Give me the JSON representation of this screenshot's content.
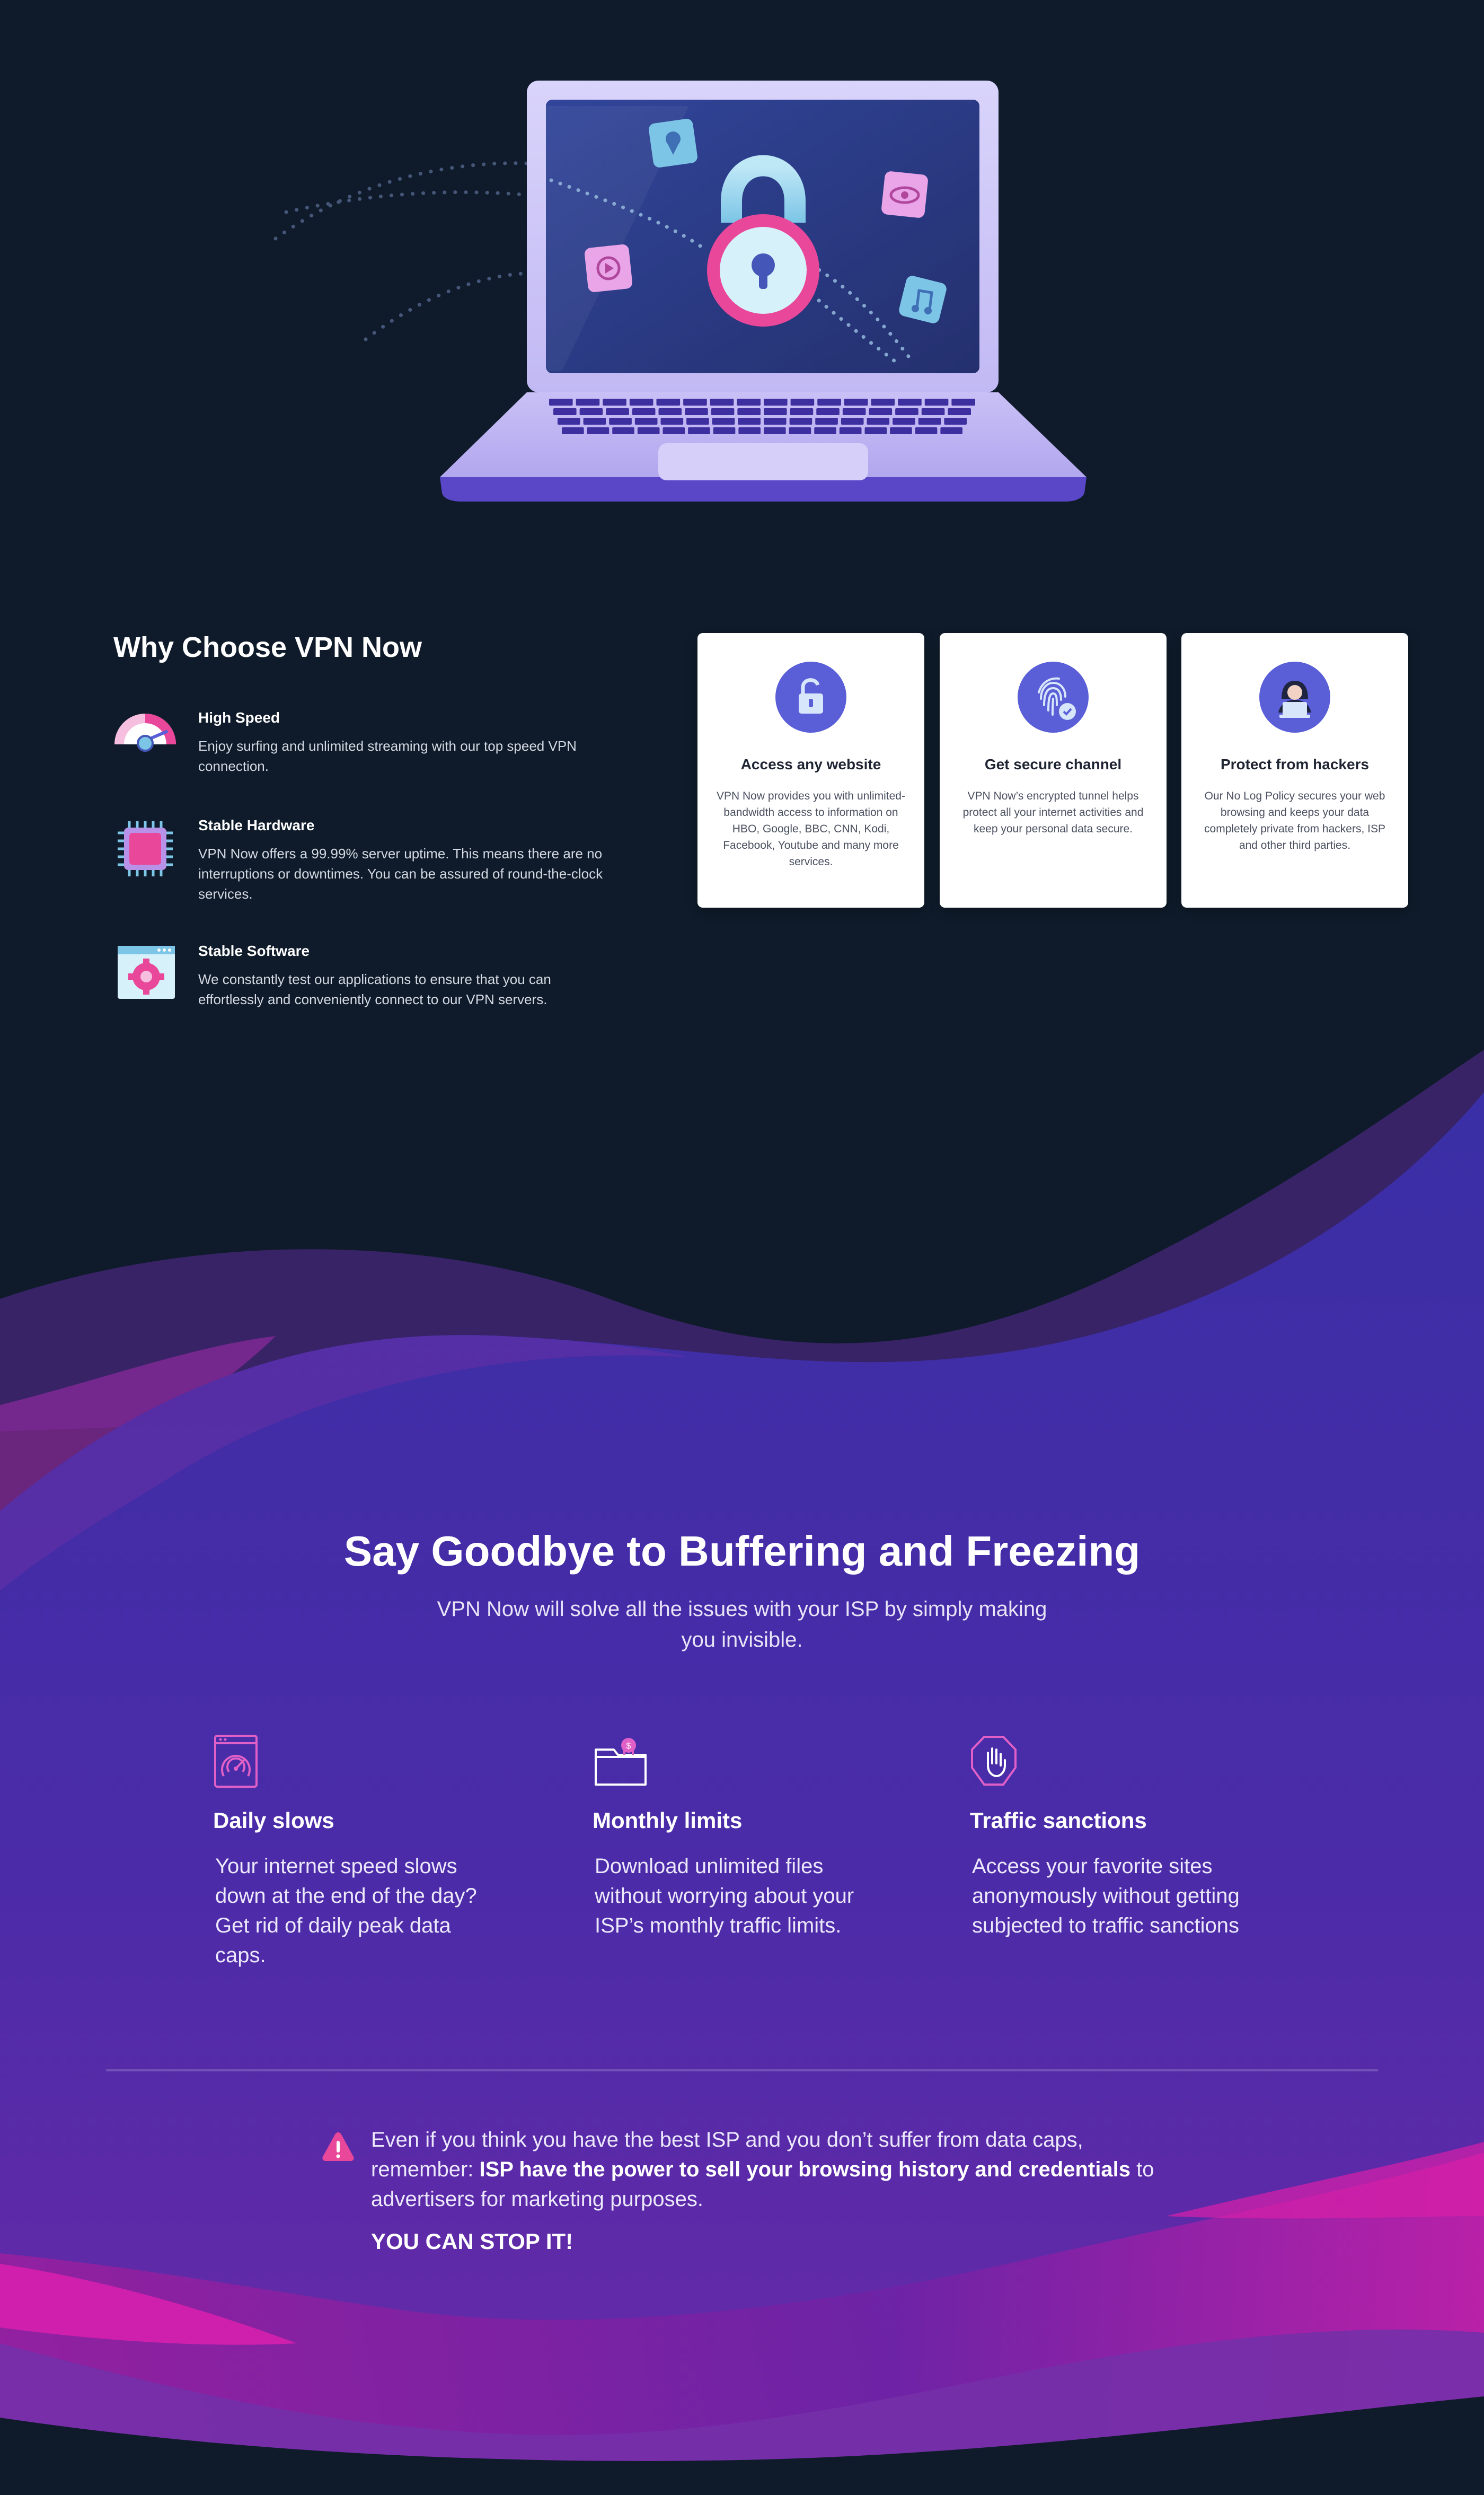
{
  "why": {
    "title": "Why Choose VPN Now",
    "features": [
      {
        "title": "High Speed",
        "desc": "Enjoy surfing and unlimited streaming with our top speed VPN connection.",
        "icon": "speedometer-icon"
      },
      {
        "title": "Stable Hardware",
        "desc": "VPN Now offers a 99.99% server uptime. This means there are no interruptions or downtimes. You can be assured of round-the-clock services.",
        "icon": "chip-icon"
      },
      {
        "title": "Stable Software",
        "desc": "We constantly test our applications to ensure that you can effortlessly and conveniently connect to our VPN servers.",
        "icon": "settings-window-icon"
      }
    ],
    "cards": [
      {
        "title": "Access any website",
        "desc": "VPN Now provides you with unlimited-bandwidth access to information on HBO, Google, BBC, CNN, Kodi, Facebook, Youtube and many more services.",
        "icon": "unlock-icon"
      },
      {
        "title": "Get secure channel",
        "desc": "VPN Now’s encrypted tunnel helps protect all your internet activities and keep your personal data secure.",
        "icon": "fingerprint-icon"
      },
      {
        "title": "Protect from hackers",
        "desc": "Our No Log Policy secures your web browsing and keeps your data completely private from hackers, ISP and other third parties.",
        "icon": "hacker-icon"
      }
    ]
  },
  "buffering": {
    "title": "Say Goodbye to Buffering and Freezing",
    "subtitle": "VPN Now will solve all the issues with your ISP by simply making you invisible.",
    "issues": [
      {
        "title": "Daily slows",
        "desc": "Your internet speed slows down at the end of the day? Get rid of daily peak data caps.",
        "icon": "speed-gauge-icon"
      },
      {
        "title": "Monthly limits",
        "desc": "Download unlimited files without worrying about your ISP’s monthly traffic limits.",
        "icon": "folder-icon"
      },
      {
        "title": "Traffic sanctions",
        "desc": "Access your favorite sites anonymously without getting subjected to traffic sanctions",
        "icon": "stop-hand-icon"
      }
    ]
  },
  "warning": {
    "text_before": "Even if you think you have the best ISP and you don’t suffer from data caps, remember: ",
    "text_bold": "ISP have the power to sell your browsing history and credentials",
    "text_after": " to advertisers for marketing purposes.",
    "cta": "YOU CAN STOP IT!",
    "icon": "warning-icon"
  },
  "colors": {
    "background": "#0f1b2a",
    "purple": "#3a2fa6",
    "magenta": "#d81fa8",
    "pink_accent": "#e8479a",
    "card_icon_blue": "#5a5fd8"
  }
}
